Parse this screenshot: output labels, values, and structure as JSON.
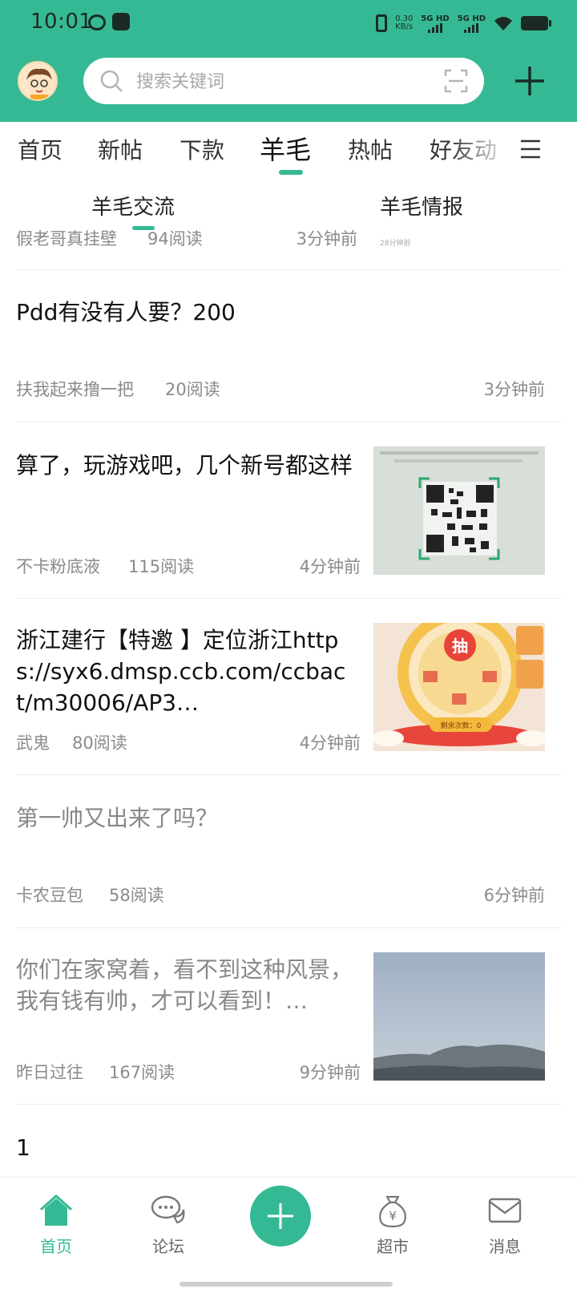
{
  "status_bar": {
    "time": "10:01",
    "net_speed": "0.30\nKB/s",
    "sig1": "5G HD",
    "sig2": "5G HD"
  },
  "search": {
    "placeholder": "搜索关键词"
  },
  "top_tabs": [
    "首页",
    "新帖",
    "下款",
    "羊毛",
    "热帖",
    "好友动"
  ],
  "active_top_tab": "羊毛",
  "sub_tabs": [
    "羊毛交流",
    "羊毛情报"
  ],
  "feed": {
    "partial_item": {
      "author": "假老哥真挂壁",
      "reads": "94阅读",
      "time": "3分钟前",
      "thumb_caption": "28分钟前"
    },
    "items": [
      {
        "title": "Pdd有没有人要？200",
        "author": "扶我起来撸一把",
        "reads": "20阅读",
        "time": "3分钟前"
      },
      {
        "title": "算了，玩游戏吧，几个新号都这样",
        "author": "不卡粉底液",
        "reads": "115阅读",
        "time": "4分钟前"
      },
      {
        "title": "浙江建行【特邀 】定位浙江https://syx6.dmsp.ccb.com/ccbact/m30006/AP3…",
        "author": "武鬼",
        "reads": "80阅读",
        "time": "4分钟前",
        "thumb_text": "抽",
        "thumb_sub": "剩余次数：0"
      },
      {
        "title": "第一帅又出来了吗？",
        "author": "卡农豆包",
        "reads": "58阅读",
        "time": "6分钟前"
      },
      {
        "title": "你们在家窝着，看不到这种风景，我有钱有帅，才可以看到！…",
        "author": "昨日过往",
        "reads": "167阅读",
        "time": "9分钟前"
      },
      {
        "title": "1"
      }
    ]
  },
  "bottom_nav": {
    "home": "首页",
    "forum": "论坛",
    "market": "超市",
    "messages": "消息"
  },
  "colors": {
    "accent": "#35b994"
  }
}
